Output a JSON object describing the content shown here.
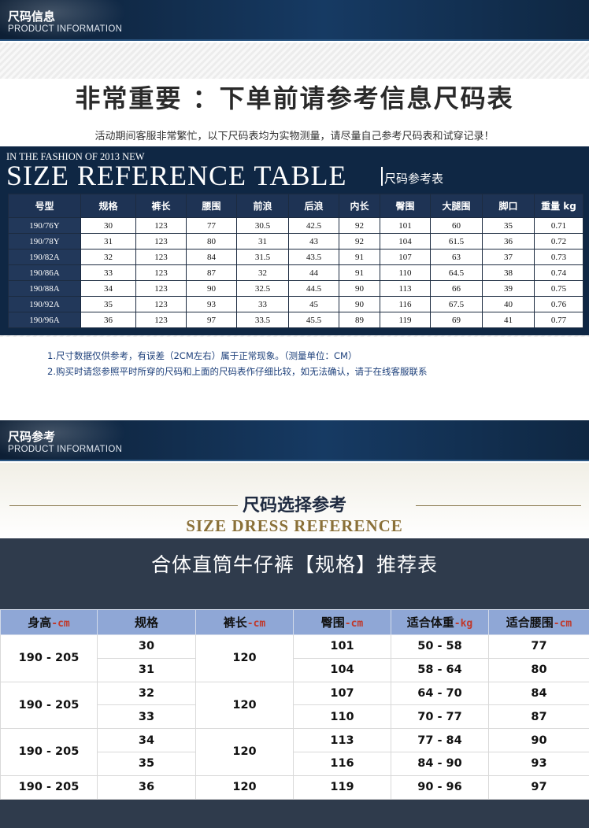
{
  "section1": {
    "title_cn": "尺码信息",
    "title_en": "PRODUCT INFORMATION"
  },
  "headline": "非常重要 ：下单前请参考信息尺码表",
  "notice": "活动期间客服非常繁忙，以下尺码表均为实物测量，请尽量自己参考尺码表和试穿记录！",
  "size_reference": {
    "subtitle": "IN THE FASHION OF 2013 NEW",
    "title": "SIZE REFERENCE TABLE",
    "title_cn": "尺码参考表"
  },
  "spec_table": {
    "headers": [
      "号型",
      "规格",
      "裤长",
      "腰围",
      "前浪",
      "后浪",
      "内长",
      "臀围",
      "大腿围",
      "脚口",
      "重量 kg"
    ],
    "rows": [
      [
        "190/76Y",
        "30",
        "123",
        "77",
        "30.5",
        "42.5",
        "92",
        "101",
        "60",
        "35",
        "0.71"
      ],
      [
        "190/78Y",
        "31",
        "123",
        "80",
        "31",
        "43",
        "92",
        "104",
        "61.5",
        "36",
        "0.72"
      ],
      [
        "190/82A",
        "32",
        "123",
        "84",
        "31.5",
        "43.5",
        "91",
        "107",
        "63",
        "37",
        "0.73"
      ],
      [
        "190/86A",
        "33",
        "123",
        "87",
        "32",
        "44",
        "91",
        "110",
        "64.5",
        "38",
        "0.74"
      ],
      [
        "190/88A",
        "34",
        "123",
        "90",
        "32.5",
        "44.5",
        "90",
        "113",
        "66",
        "39",
        "0.75"
      ],
      [
        "190/92A",
        "35",
        "123",
        "93",
        "33",
        "45",
        "90",
        "116",
        "67.5",
        "40",
        "0.76"
      ],
      [
        "190/96A",
        "36",
        "123",
        "97",
        "33.5",
        "45.5",
        "89",
        "119",
        "69",
        "41",
        "0.77"
      ]
    ]
  },
  "notes": [
    "1.尺寸数据仅供参考，有误差（2CM左右）属于正常现象。（测量单位：CM）",
    "2.购买时请您参照平时所穿的尺码和上面的尺码表作仔细比较，如无法确认，请于在线客服联系"
  ],
  "section2": {
    "title_cn": "尺码参考",
    "title_en": "PRODUCT INFORMATION"
  },
  "dress": {
    "title_cn": "尺码选择参考",
    "title_en": "SIZE DRESS REFERENCE"
  },
  "recommend": {
    "title": "合体直筒牛仔裤【规格】推荐表",
    "headers": [
      {
        "label": "身高",
        "unit": "-cm"
      },
      {
        "label": "规格",
        "unit": ""
      },
      {
        "label": "裤长",
        "unit": "-cm"
      },
      {
        "label": "臀围",
        "unit": "-cm"
      },
      {
        "label": "适合体重",
        "unit": "-kg"
      },
      {
        "label": "适合腰围",
        "unit": "-cm"
      }
    ],
    "groups": [
      {
        "height": "190 - 205",
        "length": "120",
        "rows": [
          {
            "spec": "30",
            "hip": "101",
            "weight": "50 - 58",
            "waist": "77"
          },
          {
            "spec": "31",
            "hip": "104",
            "weight": "58 - 64",
            "waist": "80"
          }
        ]
      },
      {
        "height": "190 - 205",
        "length": "120",
        "rows": [
          {
            "spec": "32",
            "hip": "107",
            "weight": "64 - 70",
            "waist": "84"
          },
          {
            "spec": "33",
            "hip": "110",
            "weight": "70 - 77",
            "waist": "87"
          }
        ]
      },
      {
        "height": "190 - 205",
        "length": "120",
        "rows": [
          {
            "spec": "34",
            "hip": "113",
            "weight": "77 - 84",
            "waist": "90"
          },
          {
            "spec": "35",
            "hip": "116",
            "weight": "84 - 90",
            "waist": "93"
          }
        ]
      },
      {
        "height": "190 - 205",
        "length": "120",
        "rows": [
          {
            "spec": "36",
            "hip": "119",
            "weight": "90 - 96",
            "waist": "97"
          }
        ]
      }
    ]
  }
}
